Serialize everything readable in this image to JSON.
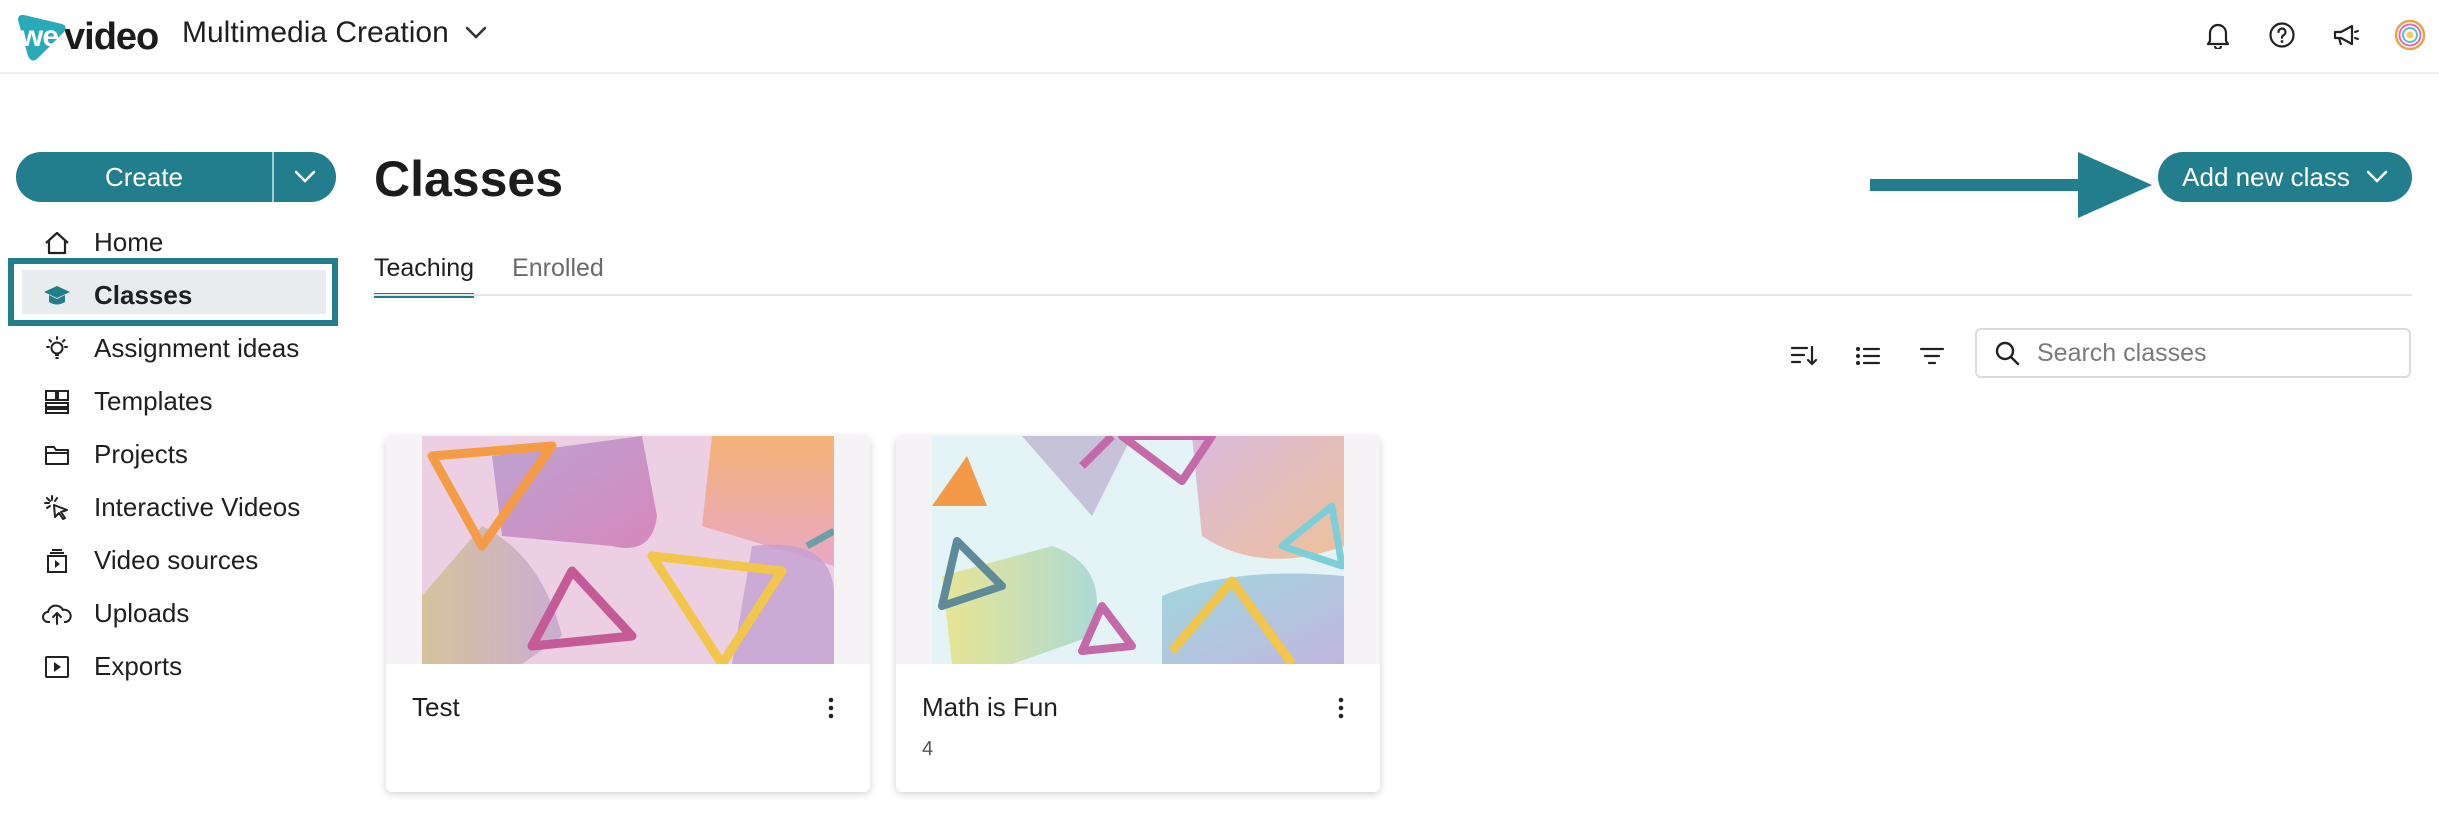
{
  "app": {
    "logo_text": "wevideo",
    "workspace": "Multimedia Creation"
  },
  "topbar": {
    "icons": [
      "bell-icon",
      "help-icon",
      "megaphone-icon",
      "user-avatar"
    ]
  },
  "sidebar": {
    "create_label": "Create",
    "items": [
      {
        "label": "Home",
        "icon": "home-icon"
      },
      {
        "label": "Classes",
        "icon": "graduation-cap-icon",
        "active": true
      },
      {
        "label": "Assignment ideas",
        "icon": "lightbulb-icon"
      },
      {
        "label": "Templates",
        "icon": "templates-icon"
      },
      {
        "label": "Projects",
        "icon": "folder-icon"
      },
      {
        "label": "Interactive Videos",
        "icon": "cursor-click-icon"
      },
      {
        "label": "Video sources",
        "icon": "video-sources-icon"
      },
      {
        "label": "Uploads",
        "icon": "cloud-upload-icon"
      },
      {
        "label": "Exports",
        "icon": "export-icon"
      }
    ]
  },
  "main": {
    "title": "Classes",
    "add_button": "Add new class",
    "tabs": [
      {
        "label": "Teaching",
        "active": true
      },
      {
        "label": "Enrolled",
        "active": false
      }
    ],
    "search_placeholder": "Search classes",
    "cards": [
      {
        "title": "Test",
        "subtitle": ""
      },
      {
        "title": "Math is Fun",
        "subtitle": "4"
      }
    ]
  },
  "colors": {
    "accent": "#227d8c",
    "active_bg": "#e9ecee"
  }
}
